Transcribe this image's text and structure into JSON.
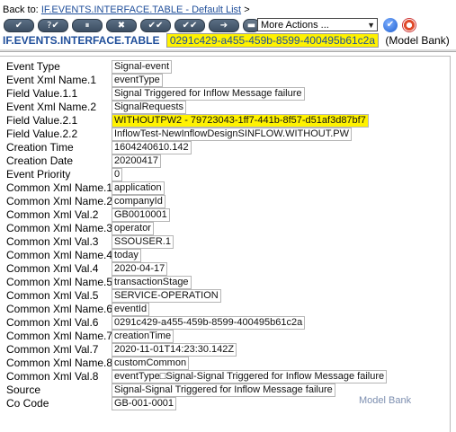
{
  "header": {
    "back_label": "Back to:",
    "back_link": "IF.EVENTS.INTERFACE.TABLE - Default List",
    "back_suffix": ">",
    "more_actions": "More Actions ...",
    "go_icon": "check-circle-icon",
    "help_icon": "lifebuoy-icon"
  },
  "toolbar": {
    "buttons": [
      "✔",
      "?✔",
      "⏸",
      "✖",
      "✔✔",
      "✔✔",
      "➔",
      "▬"
    ]
  },
  "record": {
    "application": "IF.EVENTS.INTERFACE.TABLE",
    "id": "0291c429-a455-459b-8599-400495b61c2a",
    "company": "(Model Bank)"
  },
  "fields": [
    {
      "label": "Event Type",
      "value": "Signal-event"
    },
    {
      "label": "Event Xml Name.1",
      "value": "eventType"
    },
    {
      "label": "Field Value.1.1",
      "value": "Signal Triggered for Inflow Message failure"
    },
    {
      "label": "Event Xml Name.2",
      "value": "SignalRequests"
    },
    {
      "label": "Field Value.2.1",
      "value": "WITHOUTPW2 - 79723043-1ff7-441b-8f57-d51af3d87bf7"
    },
    {
      "label": "Field Value.2.2",
      "value": "InflowTest-NewInflowDesignSINFLOW.WITHOUT.PW"
    },
    {
      "label": "Creation Time",
      "value": "1604240610.142"
    },
    {
      "label": "Creation Date",
      "value": "20200417"
    },
    {
      "label": "Event Priority",
      "value": "0"
    },
    {
      "label": "Common Xml Name.1",
      "value": "application"
    },
    {
      "label": "Common Xml Name.2",
      "value": "companyId"
    },
    {
      "label": "Common Xml Val.2",
      "value": "GB0010001"
    },
    {
      "label": "Common Xml Name.3",
      "value": "operator"
    },
    {
      "label": "Common Xml Val.3",
      "value": "SSOUSER.1"
    },
    {
      "label": "Common Xml Name.4",
      "value": "today"
    },
    {
      "label": "Common Xml Val.4",
      "value": "2020-04-17"
    },
    {
      "label": "Common Xml Name.5",
      "value": "transactionStage"
    },
    {
      "label": "Common Xml Val.5",
      "value": "SERVICE-OPERATION"
    },
    {
      "label": "Common Xml Name.6",
      "value": "eventId"
    },
    {
      "label": "Common Xml Val.6",
      "value": "0291c429-a455-459b-8599-400495b61c2a"
    },
    {
      "label": "Common Xml Name.7",
      "value": "creationTime"
    },
    {
      "label": "Common Xml Val.7",
      "value": "2020-11-01T14:23:30.142Z"
    },
    {
      "label": "Common Xml Name.8",
      "value": "customCommon"
    },
    {
      "label": "Common Xml Val.8",
      "value": "eventType□Signal-Signal Triggered for Inflow Message failure"
    },
    {
      "label": "Source",
      "value": "Signal-Signal Triggered for Inflow Message failure"
    },
    {
      "label": "Co Code",
      "value": "GB-001-0001"
    }
  ],
  "footer": {
    "company": "Model Bank"
  },
  "colors": {
    "highlight": "#fff200",
    "link": "#1f4e9a"
  }
}
